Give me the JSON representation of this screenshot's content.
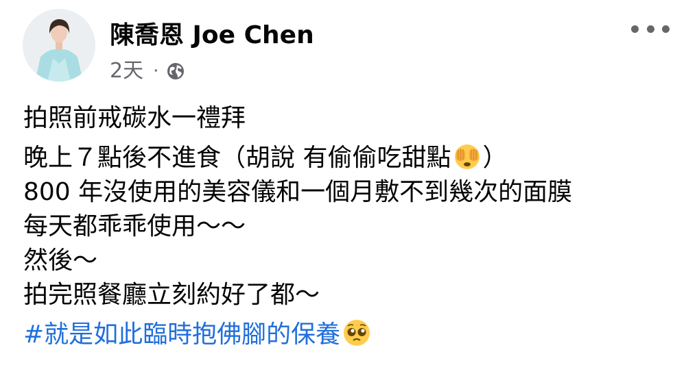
{
  "post": {
    "author": "陳喬恩 Joe Chen",
    "timestamp": "2天",
    "separator": "·",
    "privacy_icon": "globe-icon",
    "more_icon": "more-options-icon",
    "lines": [
      "拍照前戒碳水一禮拜",
      "晚上７點後不進食（胡說 有偷偷吃甜點",
      "）",
      "800 年沒使用的美容儀和一個月敷不到幾次的面膜",
      "每天都乖乖使用～～",
      "然後～",
      "拍完照餐廳立刻約好了都～"
    ],
    "hashtag": "#就是如此臨時抱佛腳的保養",
    "emojis": [
      "face-with-hand-over-eyes-emoji",
      "pleading-face-emoji"
    ]
  },
  "colors": {
    "text": "#050505",
    "secondary": "#65676b",
    "hashtag": "#216fdb"
  }
}
